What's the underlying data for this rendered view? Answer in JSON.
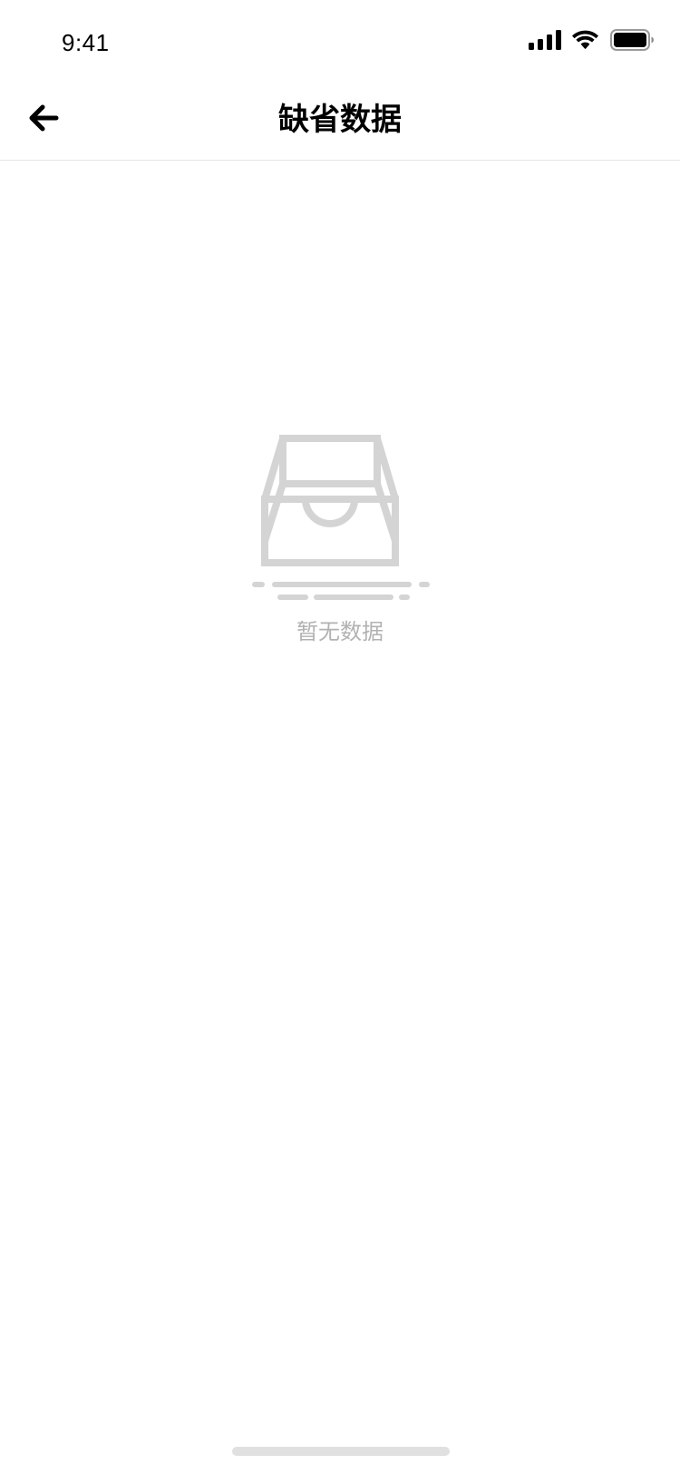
{
  "status_bar": {
    "time": "9:41",
    "icons": [
      "signal-icon",
      "wifi-icon",
      "battery-icon"
    ]
  },
  "nav_bar": {
    "back_icon": "arrow-left-icon",
    "title": "缺省数据"
  },
  "empty_state": {
    "icon": "inbox-tray-icon",
    "message": "暂无数据"
  },
  "colors": {
    "title": "#000000",
    "empty_icon": "#d4d4d4",
    "empty_text": "#b2b2b2",
    "divider": "#e5e5e5",
    "home_indicator": "#e0e0e0"
  }
}
